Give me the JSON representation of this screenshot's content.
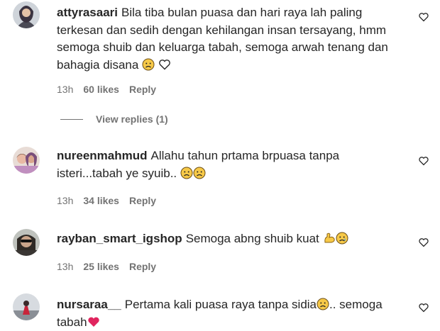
{
  "comments": [
    {
      "username": "attyrasaari",
      "text": "Bila tiba bulan puasa dan hari raya lah paling terkesan dan sedih dengan kehilangan insan tersayang, hmm semoga shuib dan keluarga tabah, semoga arwah tenang dan bahagia disana",
      "time": "13h",
      "likes": "60 likes",
      "reply": "Reply",
      "view_replies": "View replies (1)"
    },
    {
      "username": "nureenmahmud",
      "text": "Allahu tahun prtama brpuasa tanpa isteri...tabah ye syuib..",
      "time": "13h",
      "likes": "34 likes",
      "reply": "Reply"
    },
    {
      "username": "rayban_smart_igshop",
      "text": "Semoga abng shuib kuat",
      "time": "13h",
      "likes": "25 likes",
      "reply": "Reply"
    },
    {
      "username": "nursaraa__",
      "text": "Pertama kali puasa raya tanpa sidia",
      "text_after": ".. semoga tabah"
    }
  ],
  "icons": {
    "like": "heart-outline-icon",
    "colors": {
      "muted": "#737373",
      "text": "#262626",
      "red_heart": "#e0245e",
      "emoji_yellow": "#f7c948"
    }
  }
}
